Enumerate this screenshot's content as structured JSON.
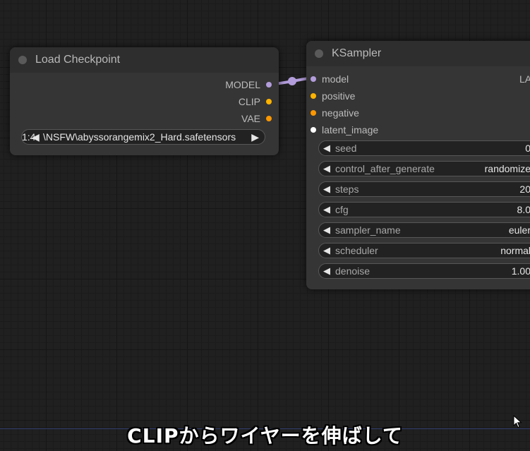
{
  "load_checkpoint": {
    "title": "Load Checkpoint",
    "outputs": [
      {
        "label": "MODEL",
        "color": "#b39ddb"
      },
      {
        "label": "CLIP",
        "color": "#ffb300"
      },
      {
        "label": "VAE",
        "color": "#ff9800"
      }
    ],
    "ckpt_widget": {
      "label": "1:4",
      "value": "\\NSFW\\abyssorangemix2_Hard.safetensors",
      "arrow_right": "▶",
      "arrow_left": "◀"
    }
  },
  "ksampler": {
    "title": "KSampler",
    "inputs": [
      {
        "label": "model",
        "color": "#b39ddb"
      },
      {
        "label": "positive",
        "color": "#ffb300"
      },
      {
        "label": "negative",
        "color": "#ff9800"
      },
      {
        "label": "latent_image",
        "color": "#ffffff"
      }
    ],
    "output_label": "LA",
    "widgets": [
      {
        "label": "seed",
        "value": "0"
      },
      {
        "label": "control_after_generate",
        "value": "randomize"
      },
      {
        "label": "steps",
        "value": "20"
      },
      {
        "label": "cfg",
        "value": "8.0"
      },
      {
        "label": "sampler_name",
        "value": "euler"
      },
      {
        "label": "scheduler",
        "value": "normal"
      },
      {
        "label": "denoise",
        "value": "1.00"
      }
    ]
  },
  "link_color": "#b39ddb",
  "caption": "CLIPからワイヤーを伸ばして",
  "cursor_icon": "mouse-pointer-icon"
}
